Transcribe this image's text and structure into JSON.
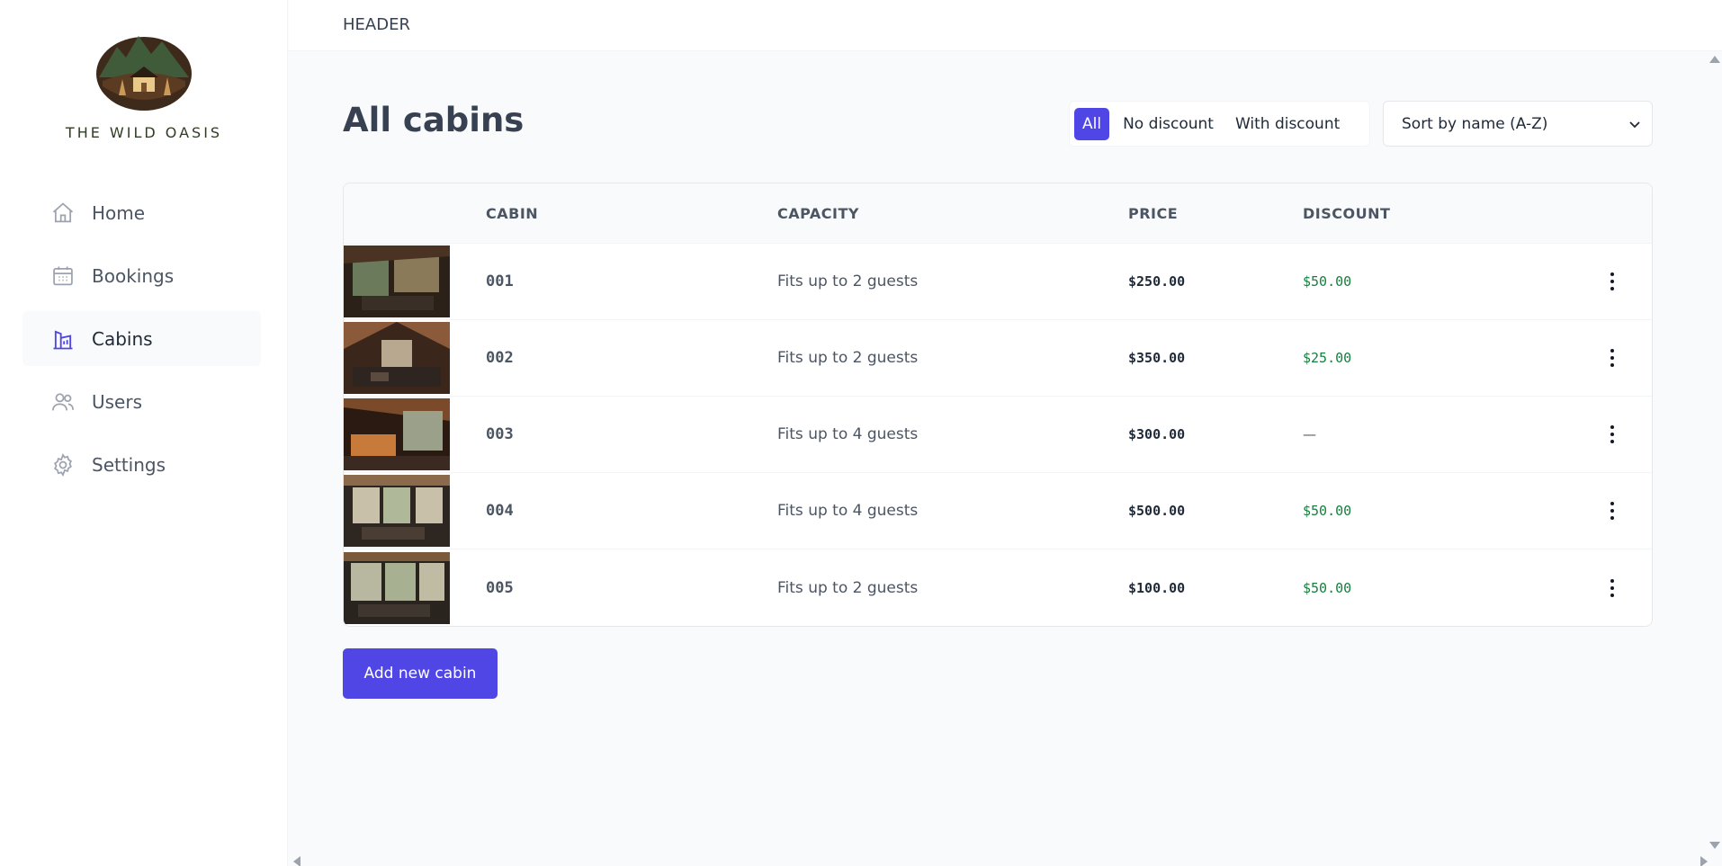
{
  "brand": {
    "name": "THE WILD OASIS",
    "logo": "mountain-cabin-logo"
  },
  "sidebar": {
    "items": [
      {
        "label": "Home",
        "icon": "home-icon"
      },
      {
        "label": "Bookings",
        "icon": "calendar-icon"
      },
      {
        "label": "Cabins",
        "icon": "cabin-icon",
        "active": true
      },
      {
        "label": "Users",
        "icon": "users-icon"
      },
      {
        "label": "Settings",
        "icon": "gear-icon"
      }
    ]
  },
  "header": {
    "title": "HEADER"
  },
  "page": {
    "title": "All cabins"
  },
  "filter": {
    "options": [
      "All",
      "No discount",
      "With discount"
    ],
    "active": "All"
  },
  "sort": {
    "selected": "Sort by name (A-Z)"
  },
  "table": {
    "columns": [
      "",
      "CABIN",
      "CAPACITY",
      "PRICE",
      "DISCOUNT",
      ""
    ],
    "rows": [
      {
        "name": "001",
        "capacity": "Fits up to 2 guests",
        "price": "$250.00",
        "discount": "$50.00"
      },
      {
        "name": "002",
        "capacity": "Fits up to 2 guests",
        "price": "$350.00",
        "discount": "$25.00"
      },
      {
        "name": "003",
        "capacity": "Fits up to 4 guests",
        "price": "$300.00",
        "discount": "—"
      },
      {
        "name": "004",
        "capacity": "Fits up to 4 guests",
        "price": "$500.00",
        "discount": "$50.00"
      },
      {
        "name": "005",
        "capacity": "Fits up to 2 guests",
        "price": "$100.00",
        "discount": "$50.00"
      }
    ]
  },
  "actions": {
    "add_label": "Add new cabin"
  },
  "colors": {
    "accent": "#4f46e5",
    "discount": "#15803d",
    "brand_text": "#2f3d24"
  }
}
